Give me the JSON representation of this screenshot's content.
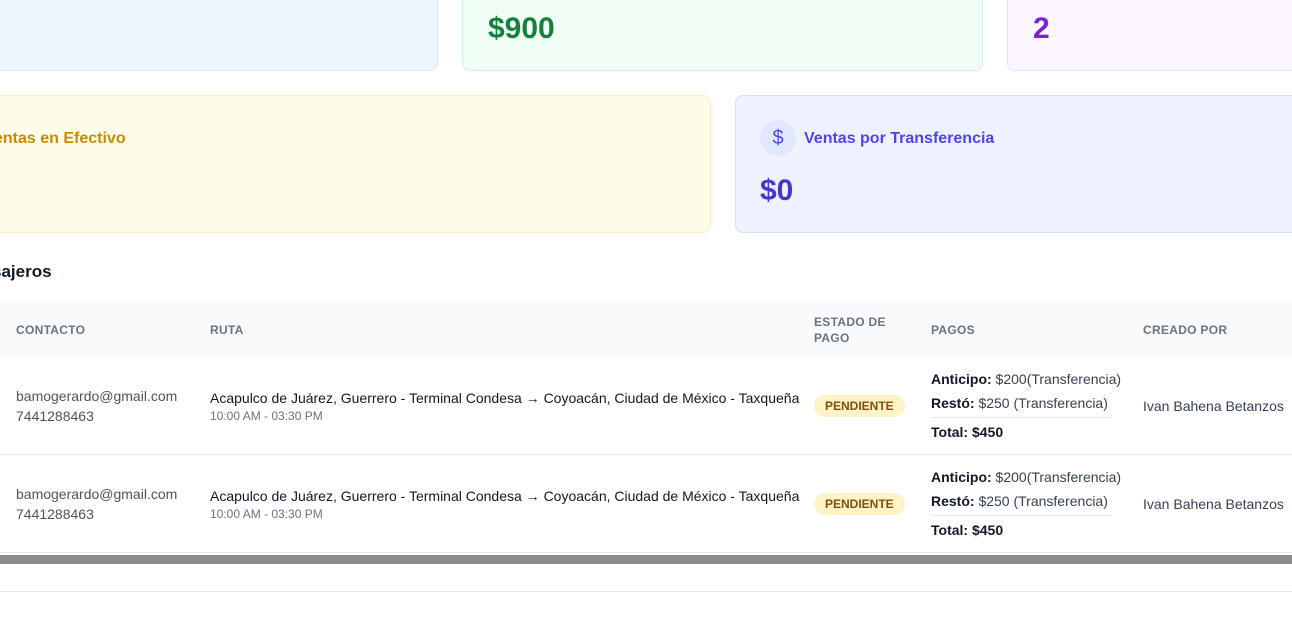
{
  "stats": {
    "total_value": "$900",
    "count_value": "2"
  },
  "sales": {
    "cash": {
      "title": "entas en Efectivo"
    },
    "transfer": {
      "title": "Ventas por Transferencia",
      "value": "$0",
      "icon": "dollar-icon"
    }
  },
  "section": {
    "title": "sajeros"
  },
  "table": {
    "headers": {
      "contact": "CONTACTO",
      "route": "RUTA",
      "payment_status_line1": "ESTADO DE",
      "payment_status_line2": "PAGO",
      "payments": "PAGOS",
      "created_by": "CREADO POR"
    },
    "rows": [
      {
        "email": "bamogerardo@gmail.com",
        "phone": "7441288463",
        "route": "Acapulco de Juárez, Guerrero - Terminal Condesa → Coyoacán, Ciudad de México - Taxqueña",
        "time": "10:00 AM - 03:30 PM",
        "status": "PENDIENTE",
        "anticipo_label": "Anticipo:",
        "anticipo_value": " $200(Transferencia)",
        "resto_label": "Restó:",
        "resto_value": " $250 (Transferencia)",
        "total": "Total: $450",
        "created_by": "Ivan Bahena Betanzos"
      },
      {
        "email": "bamogerardo@gmail.com",
        "phone": "7441288463",
        "route": "Acapulco de Juárez, Guerrero - Terminal Condesa → Coyoacán, Ciudad de México - Taxqueña",
        "time": "10:00 AM - 03:30 PM",
        "status": "PENDIENTE",
        "anticipo_label": "Anticipo:",
        "anticipo_value": " $200(Transferencia)",
        "resto_label": "Restó:",
        "resto_value": " $250 (Transferencia)",
        "total": "Total: $450",
        "created_by": "Ivan Bahena Betanzos"
      }
    ]
  },
  "colors": {
    "green": "#15803d",
    "purple": "#7e22ce",
    "indigo": "#4338ca",
    "yellow": "#ca8a04",
    "badge_bg": "#fef3c7"
  }
}
